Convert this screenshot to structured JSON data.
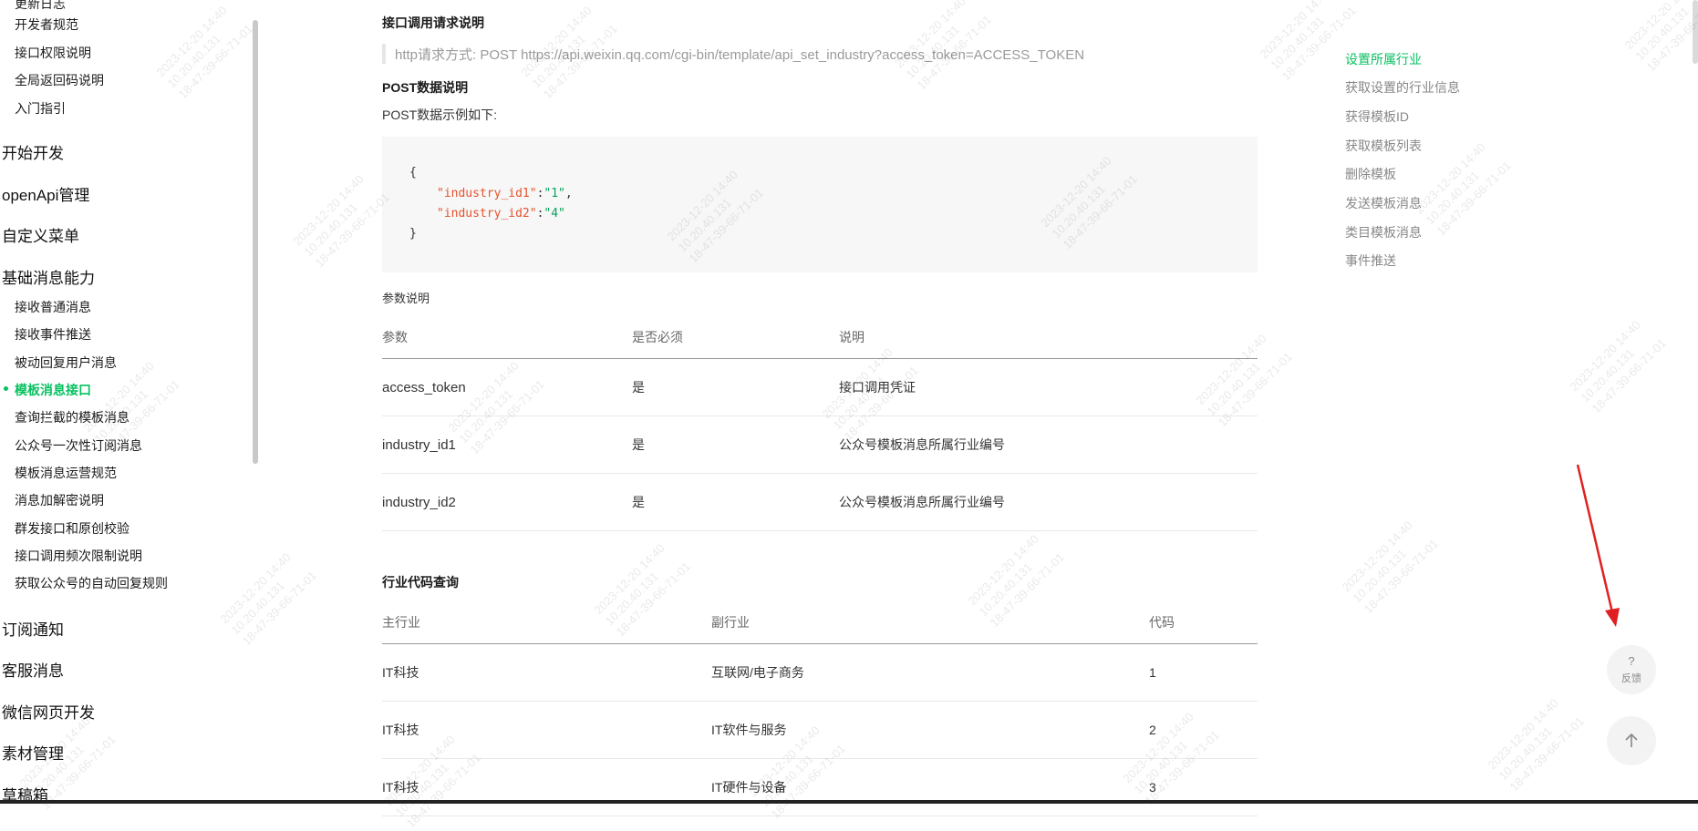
{
  "sidebar": {
    "partial_top": "更新日志",
    "top_items": [
      "开发者规范",
      "接口权限说明",
      "全局返回码说明",
      "入门指引"
    ],
    "groups": {
      "start_dev": "开始开发",
      "openapi": "openApi管理",
      "custom_menu": "自定义菜单",
      "basic_msg": "基础消息能力"
    },
    "basic_msg_items": [
      {
        "label": "接收普通消息",
        "active": false
      },
      {
        "label": "接收事件推送",
        "active": false
      },
      {
        "label": "被动回复用户消息",
        "active": false
      },
      {
        "label": "模板消息接口",
        "active": true
      },
      {
        "label": "查询拦截的模板消息",
        "active": false
      },
      {
        "label": "公众号一次性订阅消息",
        "active": false
      },
      {
        "label": "模板消息运营规范",
        "active": false
      },
      {
        "label": "消息加解密说明",
        "active": false
      },
      {
        "label": "群发接口和原创校验",
        "active": false
      },
      {
        "label": "接口调用频次限制说明",
        "active": false
      },
      {
        "label": "获取公众号的自动回复规则",
        "active": false
      }
    ],
    "bottom_groups": [
      "订阅通知",
      "客服消息",
      "微信网页开发",
      "素材管理",
      "草稿箱"
    ]
  },
  "content": {
    "request_heading": "接口调用请求说明",
    "http_line": "http请求方式: POST https://api.weixin.qq.com/cgi-bin/template/api_set_industry?access_token=ACCESS_TOKEN",
    "post_heading": "POST数据说明",
    "post_example_label": "POST数据示例如下:",
    "code": {
      "open": "{",
      "line1_key": "\"industry_id1\"",
      "line1_val": "\"1\"",
      "line2_key": "\"industry_id2\"",
      "line2_val": "\"4\"",
      "close": "}"
    },
    "params_label": "参数说明",
    "params_table": {
      "headers": [
        "参数",
        "是否必须",
        "说明"
      ],
      "rows": [
        [
          "access_token",
          "是",
          "接口调用凭证"
        ],
        [
          "industry_id1",
          "是",
          "公众号模板消息所属行业编号"
        ],
        [
          "industry_id2",
          "是",
          "公众号模板消息所属行业编号"
        ]
      ]
    },
    "industry_heading": "行业代码查询",
    "industry_table": {
      "headers": [
        "主行业",
        "副行业",
        "代码"
      ],
      "rows": [
        [
          "IT科技",
          "互联网/电子商务",
          "1"
        ],
        [
          "IT科技",
          "IT软件与服务",
          "2"
        ],
        [
          "IT科技",
          "IT硬件与设备",
          "3"
        ]
      ]
    }
  },
  "toc": [
    {
      "label": "设置所属行业",
      "active": true
    },
    {
      "label": "获取设置的行业信息",
      "active": false
    },
    {
      "label": "获得模板ID",
      "active": false
    },
    {
      "label": "获取模板列表",
      "active": false
    },
    {
      "label": "删除模板",
      "active": false
    },
    {
      "label": "发送模板消息",
      "active": false
    },
    {
      "label": "类目模板消息",
      "active": false
    },
    {
      "label": "事件推送",
      "active": false
    }
  ],
  "float_buttons": {
    "feedback_icon": "question-mark-icon",
    "feedback_symbol": "?",
    "feedback_label": "反馈",
    "top_icon": "arrow-up-icon"
  },
  "watermark": {
    "text": "2023-12-20 14:40\n10.20.40.131\n18-47-39-66-71-01"
  },
  "colors": {
    "accent": "#07c160",
    "annotation": "#e02020",
    "code_key": "#e5532d",
    "code_value": "#07a35a"
  }
}
